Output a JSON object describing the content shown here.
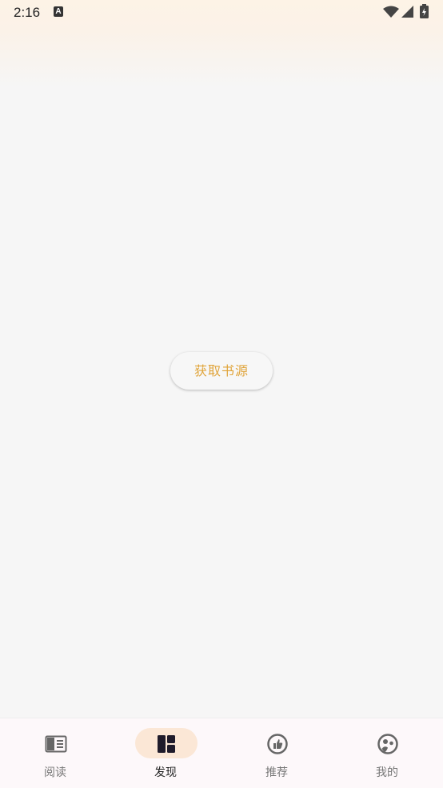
{
  "status_bar": {
    "time": "2:16",
    "notification_icon": "A",
    "icons": [
      "wifi-icon",
      "signal-icon",
      "battery-icon"
    ]
  },
  "main": {
    "get_source_button": "获取书源"
  },
  "bottom_nav": {
    "active_index": 1,
    "items": [
      {
        "label": "阅读",
        "icon": "book-icon"
      },
      {
        "label": "发现",
        "icon": "discover-icon"
      },
      {
        "label": "推荐",
        "icon": "thumbs-up-icon"
      },
      {
        "label": "我的",
        "icon": "profile-icon"
      }
    ]
  },
  "colors": {
    "accent": "#e0a43a",
    "active_pill": "#fbe7d6",
    "background": "#f6f6f6"
  }
}
